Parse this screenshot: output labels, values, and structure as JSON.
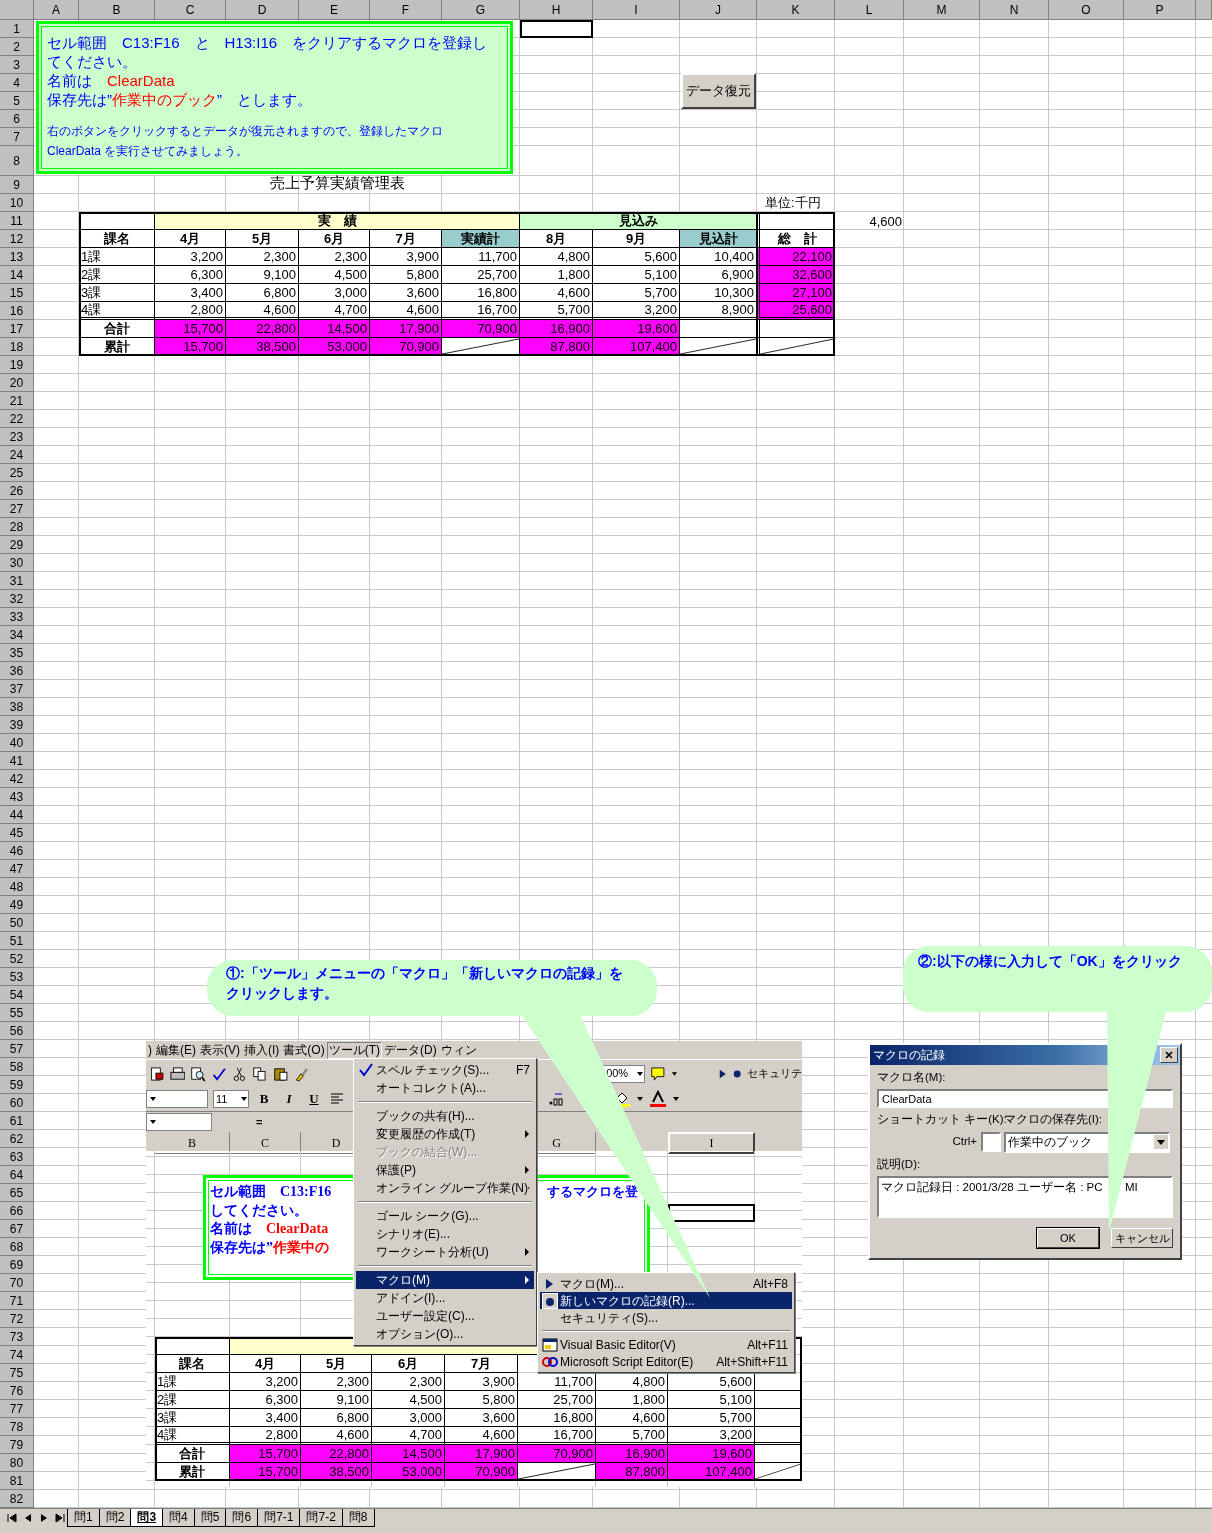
{
  "columns": [
    "A",
    "B",
    "C",
    "D",
    "E",
    "F",
    "G",
    "H",
    "I",
    "J",
    "K",
    "L",
    "M",
    "N",
    "O",
    "P"
  ],
  "rows": [
    "1",
    "2",
    "3",
    "4",
    "5",
    "6",
    "7",
    "8",
    "9",
    "10",
    "11",
    "12",
    "13",
    "14",
    "15",
    "16",
    "17",
    "18",
    "19",
    "20",
    "21",
    "22",
    "23",
    "24",
    "25",
    "26",
    "27",
    "28",
    "29",
    "30",
    "31",
    "32",
    "33",
    "34",
    "35",
    "36",
    "37",
    "38",
    "39",
    "40",
    "41",
    "42",
    "43",
    "44",
    "45",
    "46",
    "47",
    "48",
    "49",
    "50",
    "51",
    "52",
    "53",
    "54",
    "55",
    "56",
    "57",
    "58",
    "59",
    "60",
    "61",
    "62",
    "63",
    "64",
    "65",
    "66",
    "67",
    "68",
    "69",
    "70",
    "71",
    "72",
    "73",
    "74",
    "75",
    "76",
    "77",
    "78",
    "79",
    "80",
    "81",
    "82"
  ],
  "instruction_box": {
    "paragraphs": [
      {
        "kind": "main",
        "parts": [
          {
            "text": "セル範囲　C13:F16　と　H13:I16　をクリアするマクロを登録してください。",
            "emphasis": false
          }
        ]
      },
      {
        "kind": "main",
        "parts": [
          {
            "text": "名前は　",
            "emphasis": false
          },
          {
            "text": "ClearData",
            "emphasis": true
          }
        ]
      },
      {
        "kind": "main",
        "parts": [
          {
            "text": "保存先は”",
            "emphasis": false
          },
          {
            "text": "作業中のブック",
            "emphasis": true
          },
          {
            "text": "”　とします。",
            "emphasis": false
          }
        ]
      },
      {
        "kind": "note",
        "parts": [
          {
            "text": "右のボタンをクリックするとデータが復元されますので、登録したマクロ　ClearData を実行させてみましょう。",
            "emphasis": false
          }
        ]
      }
    ]
  },
  "restore_button": "データ復元",
  "sheet_title": "売上予算実績管理表",
  "unit_label": "単位:千円",
  "stray_value": "4,600",
  "table": {
    "groups": [
      {
        "text": "実　績",
        "color": "#ffffcc"
      },
      {
        "text": "見込み",
        "color": "#ccffcc"
      }
    ],
    "columns": [
      {
        "text": "課名",
        "shaded": false
      },
      {
        "text": "4月",
        "shaded": false
      },
      {
        "text": "5月",
        "shaded": false
      },
      {
        "text": "6月",
        "shaded": false
      },
      {
        "text": "7月",
        "shaded": false
      },
      {
        "text": "実績計",
        "shaded": true
      },
      {
        "text": "8月",
        "shaded": false
      },
      {
        "text": "9月",
        "shaded": false
      },
      {
        "text": "見込計",
        "shaded": true
      },
      {
        "text": "総　計",
        "shaded": false
      }
    ],
    "rows": [
      {
        "label": "1課",
        "values": [
          "3,200",
          "2,300",
          "2,300",
          "3,900",
          "11,700",
          "4,800",
          "5,600",
          "10,400"
        ],
        "total": {
          "text": "22,100",
          "highlighted": true
        }
      },
      {
        "label": "2課",
        "values": [
          "6,300",
          "9,100",
          "4,500",
          "5,800",
          "25,700",
          "1,800",
          "5,100",
          "6,900"
        ],
        "total": {
          "text": "32,600",
          "highlighted": true
        }
      },
      {
        "label": "3課",
        "values": [
          "3,400",
          "6,800",
          "3,000",
          "3,600",
          "16,800",
          "4,600",
          "5,700",
          "10,300"
        ],
        "total": {
          "text": "27,100",
          "highlighted": true
        }
      },
      {
        "label": "4課",
        "values": [
          "2,800",
          "4,600",
          "4,700",
          "4,600",
          "16,700",
          "5,700",
          "3,200",
          "8,900"
        ],
        "total": {
          "text": "25,600",
          "highlighted": true
        }
      }
    ],
    "summary": [
      {
        "label": "合計",
        "cells": [
          {
            "kind": "value",
            "text": "15,700",
            "highlighted": true
          },
          {
            "kind": "value",
            "text": "22,800",
            "highlighted": true
          },
          {
            "kind": "value",
            "text": "14,500",
            "highlighted": true
          },
          {
            "kind": "value",
            "text": "17,900",
            "highlighted": true
          },
          {
            "kind": "value",
            "text": "70,900",
            "highlighted": true
          },
          {
            "kind": "value",
            "text": "16,900",
            "highlighted": true
          },
          {
            "kind": "value",
            "text": "19,600",
            "highlighted": true
          },
          {
            "kind": "blank"
          },
          {
            "kind": "blank"
          }
        ]
      },
      {
        "label": "累計",
        "cells": [
          {
            "kind": "value",
            "text": "15,700",
            "highlighted": true
          },
          {
            "kind": "value",
            "text": "38,500",
            "highlighted": true
          },
          {
            "kind": "value",
            "text": "53,000",
            "highlighted": true
          },
          {
            "kind": "value",
            "text": "70,900",
            "highlighted": true
          },
          {
            "kind": "slash"
          },
          {
            "kind": "value",
            "text": "87,800",
            "highlighted": true
          },
          {
            "kind": "value",
            "text": "107,400",
            "highlighted": true
          },
          {
            "kind": "slash"
          },
          {
            "kind": "slash"
          }
        ]
      }
    ]
  },
  "callouts": [
    {
      "text": "①:「ツール」メニューの「マクロ」「新しいマクロの記録」をクリックします。"
    },
    {
      "text": "②:以下の様に入力して「OK」をクリック"
    }
  ],
  "tutorial_screenshot": {
    "menu_bar": [
      {
        "label": ")",
        "selected": false
      },
      {
        "label": "編集(E)",
        "selected": false
      },
      {
        "label": "表示(V)",
        "selected": false
      },
      {
        "label": "挿入(I)",
        "selected": false
      },
      {
        "label": "書式(O)",
        "selected": false
      },
      {
        "label": "ツール(T)",
        "selected": true
      },
      {
        "label": "データ(D)",
        "selected": false
      },
      {
        "label": "ウィン",
        "selected": false
      }
    ],
    "zoom": "00%",
    "security_label": "セキュリテ",
    "font_size": "11",
    "format_buttons": [
      "B",
      "I",
      "U"
    ],
    "formula_sign": "=",
    "column_headers": [
      {
        "text": "B",
        "selected": false
      },
      {
        "text": "C",
        "selected": false
      },
      {
        "text": "D",
        "selected": false
      },
      {
        "text": "G",
        "selected": false
      },
      {
        "text": "I",
        "selected": true
      }
    ],
    "text_box": {
      "lines": [
        [
          {
            "text": "セル範囲　C13:F16",
            "emphasis": false
          }
        ],
        [
          {
            "text": "してください。",
            "emphasis": false
          }
        ],
        [
          {
            "text": "名前は　",
            "emphasis": false
          },
          {
            "text": "ClearData",
            "emphasis": true
          }
        ],
        [
          {
            "text": "保存先は”",
            "emphasis": false
          },
          {
            "text": "作業中の",
            "emphasis": true
          }
        ]
      ],
      "fragment": "するマクロを登"
    },
    "tools_menu": [
      {
        "kind": "item",
        "label": "スペル チェック(S)...",
        "shortcut": "F7",
        "submenu": false,
        "disabled": false,
        "selected": false
      },
      {
        "kind": "item",
        "label": "オートコレクト(A)...",
        "submenu": false,
        "disabled": false,
        "selected": false
      },
      {
        "kind": "separator"
      },
      {
        "kind": "item",
        "label": "ブックの共有(H)...",
        "submenu": false,
        "disabled": false,
        "selected": false
      },
      {
        "kind": "item",
        "label": "変更履歴の作成(T)",
        "submenu": true,
        "disabled": false,
        "selected": false
      },
      {
        "kind": "item",
        "label": "ブックの結合(W)...",
        "submenu": false,
        "disabled": true,
        "selected": false
      },
      {
        "kind": "item",
        "label": "保護(P)",
        "submenu": true,
        "disabled": false,
        "selected": false
      },
      {
        "kind": "item",
        "label": "オンライン グループ作業(N)",
        "submenu": true,
        "disabled": false,
        "selected": false
      },
      {
        "kind": "separator"
      },
      {
        "kind": "item",
        "label": "ゴール シーク(G)...",
        "submenu": false,
        "disabled": false,
        "selected": false
      },
      {
        "kind": "item",
        "label": "シナリオ(E)...",
        "submenu": false,
        "disabled": false,
        "selected": false
      },
      {
        "kind": "item",
        "label": "ワークシート分析(U)",
        "submenu": true,
        "disabled": false,
        "selected": false
      },
      {
        "kind": "separator"
      },
      {
        "kind": "item",
        "label": "マクロ(M)",
        "submenu": true,
        "disabled": false,
        "selected": true
      },
      {
        "kind": "item",
        "label": "アドイン(I)...",
        "submenu": false,
        "disabled": false,
        "selected": false
      },
      {
        "kind": "item",
        "label": "ユーザー設定(C)...",
        "submenu": false,
        "disabled": false,
        "selected": false
      },
      {
        "kind": "item",
        "label": "オプション(O)...",
        "submenu": false,
        "disabled": false,
        "selected": false
      }
    ],
    "macro_submenu": [
      {
        "kind": "item",
        "label": "マクロ(M)...",
        "shortcut": "Alt+F8",
        "selected": false
      },
      {
        "kind": "item",
        "label": "新しいマクロの記録(R)...",
        "selected": true
      },
      {
        "kind": "item",
        "label": "セキュリティ(S)...",
        "selected": false
      },
      {
        "kind": "separator"
      },
      {
        "kind": "item",
        "label": "Visual Basic Editor(V)",
        "shortcut": "Alt+F11",
        "selected": false
      },
      {
        "kind": "item",
        "label": "Microsoft Script Editor(E)",
        "shortcut": "Alt+Shift+F11",
        "selected": false
      }
    ],
    "table": {
      "columns": [
        "課名",
        "4月",
        "5月",
        "6月",
        "7月"
      ],
      "rows": [
        {
          "label": "1課",
          "values": [
            "3,200",
            "2,300",
            "2,300",
            "3,900",
            "11,700",
            "4,800",
            "5,600"
          ]
        },
        {
          "label": "2課",
          "values": [
            "6,300",
            "9,100",
            "4,500",
            "5,800",
            "25,700",
            "1,800",
            "5,100"
          ]
        },
        {
          "label": "3課",
          "values": [
            "3,400",
            "6,800",
            "3,000",
            "3,600",
            "16,800",
            "4,600",
            "5,700"
          ]
        },
        {
          "label": "4課",
          "values": [
            "2,800",
            "4,600",
            "4,700",
            "4,600",
            "16,700",
            "5,700",
            "3,200"
          ]
        }
      ],
      "summary": [
        {
          "label": "合計",
          "cells": [
            {
              "kind": "value",
              "text": "15,700",
              "highlighted": true
            },
            {
              "kind": "value",
              "text": "22,800",
              "highlighted": true
            },
            {
              "kind": "value",
              "text": "14,500",
              "highlighted": true
            },
            {
              "kind": "value",
              "text": "17,900",
              "highlighted": true
            },
            {
              "kind": "value",
              "text": "70,900",
              "highlighted": true
            },
            {
              "kind": "value",
              "text": "16,900",
              "highlighted": true
            },
            {
              "kind": "value",
              "text": "19,600",
              "highlighted": true
            },
            {
              "kind": "blank"
            }
          ]
        },
        {
          "label": "累計",
          "cells": [
            {
              "kind": "value",
              "text": "15,700",
              "highlighted": true
            },
            {
              "kind": "value",
              "text": "38,500",
              "highlighted": true
            },
            {
              "kind": "value",
              "text": "53,000",
              "highlighted": true
            },
            {
              "kind": "value",
              "text": "70,900",
              "highlighted": true
            },
            {
              "kind": "slash"
            },
            {
              "kind": "value",
              "text": "87,800",
              "highlighted": true
            },
            {
              "kind": "value",
              "text": "107,400",
              "highlighted": true
            },
            {
              "kind": "slash"
            }
          ]
        }
      ]
    }
  },
  "dialog": {
    "title": "マクロの記録",
    "name_label": "マクロ名(M):",
    "name_value": "ClearData",
    "shortcut_label": "ショートカット キー(K):",
    "ctrl_label": "Ctrl+",
    "store_label": "マクロの保存先(I):",
    "store_value": "作業中のブック",
    "description_label": "説明(D):",
    "description_parts": [
      "マクロ記録日 : 2001/3/28  ユーザー名 : PC",
      "MI"
    ],
    "buttons": [
      {
        "label": "OK",
        "default": true
      },
      {
        "label": "キャンセル",
        "default": false
      }
    ]
  },
  "sheet_tabs": [
    {
      "label": "問1",
      "selected": false
    },
    {
      "label": "問2",
      "selected": false
    },
    {
      "label": "問3",
      "selected": true
    },
    {
      "label": "問4",
      "selected": false
    },
    {
      "label": "問5",
      "selected": false
    },
    {
      "label": "問6",
      "selected": false
    },
    {
      "label": "問7-1",
      "selected": false
    },
    {
      "label": "問7-2",
      "selected": false
    },
    {
      "label": "問8",
      "selected": false
    }
  ]
}
